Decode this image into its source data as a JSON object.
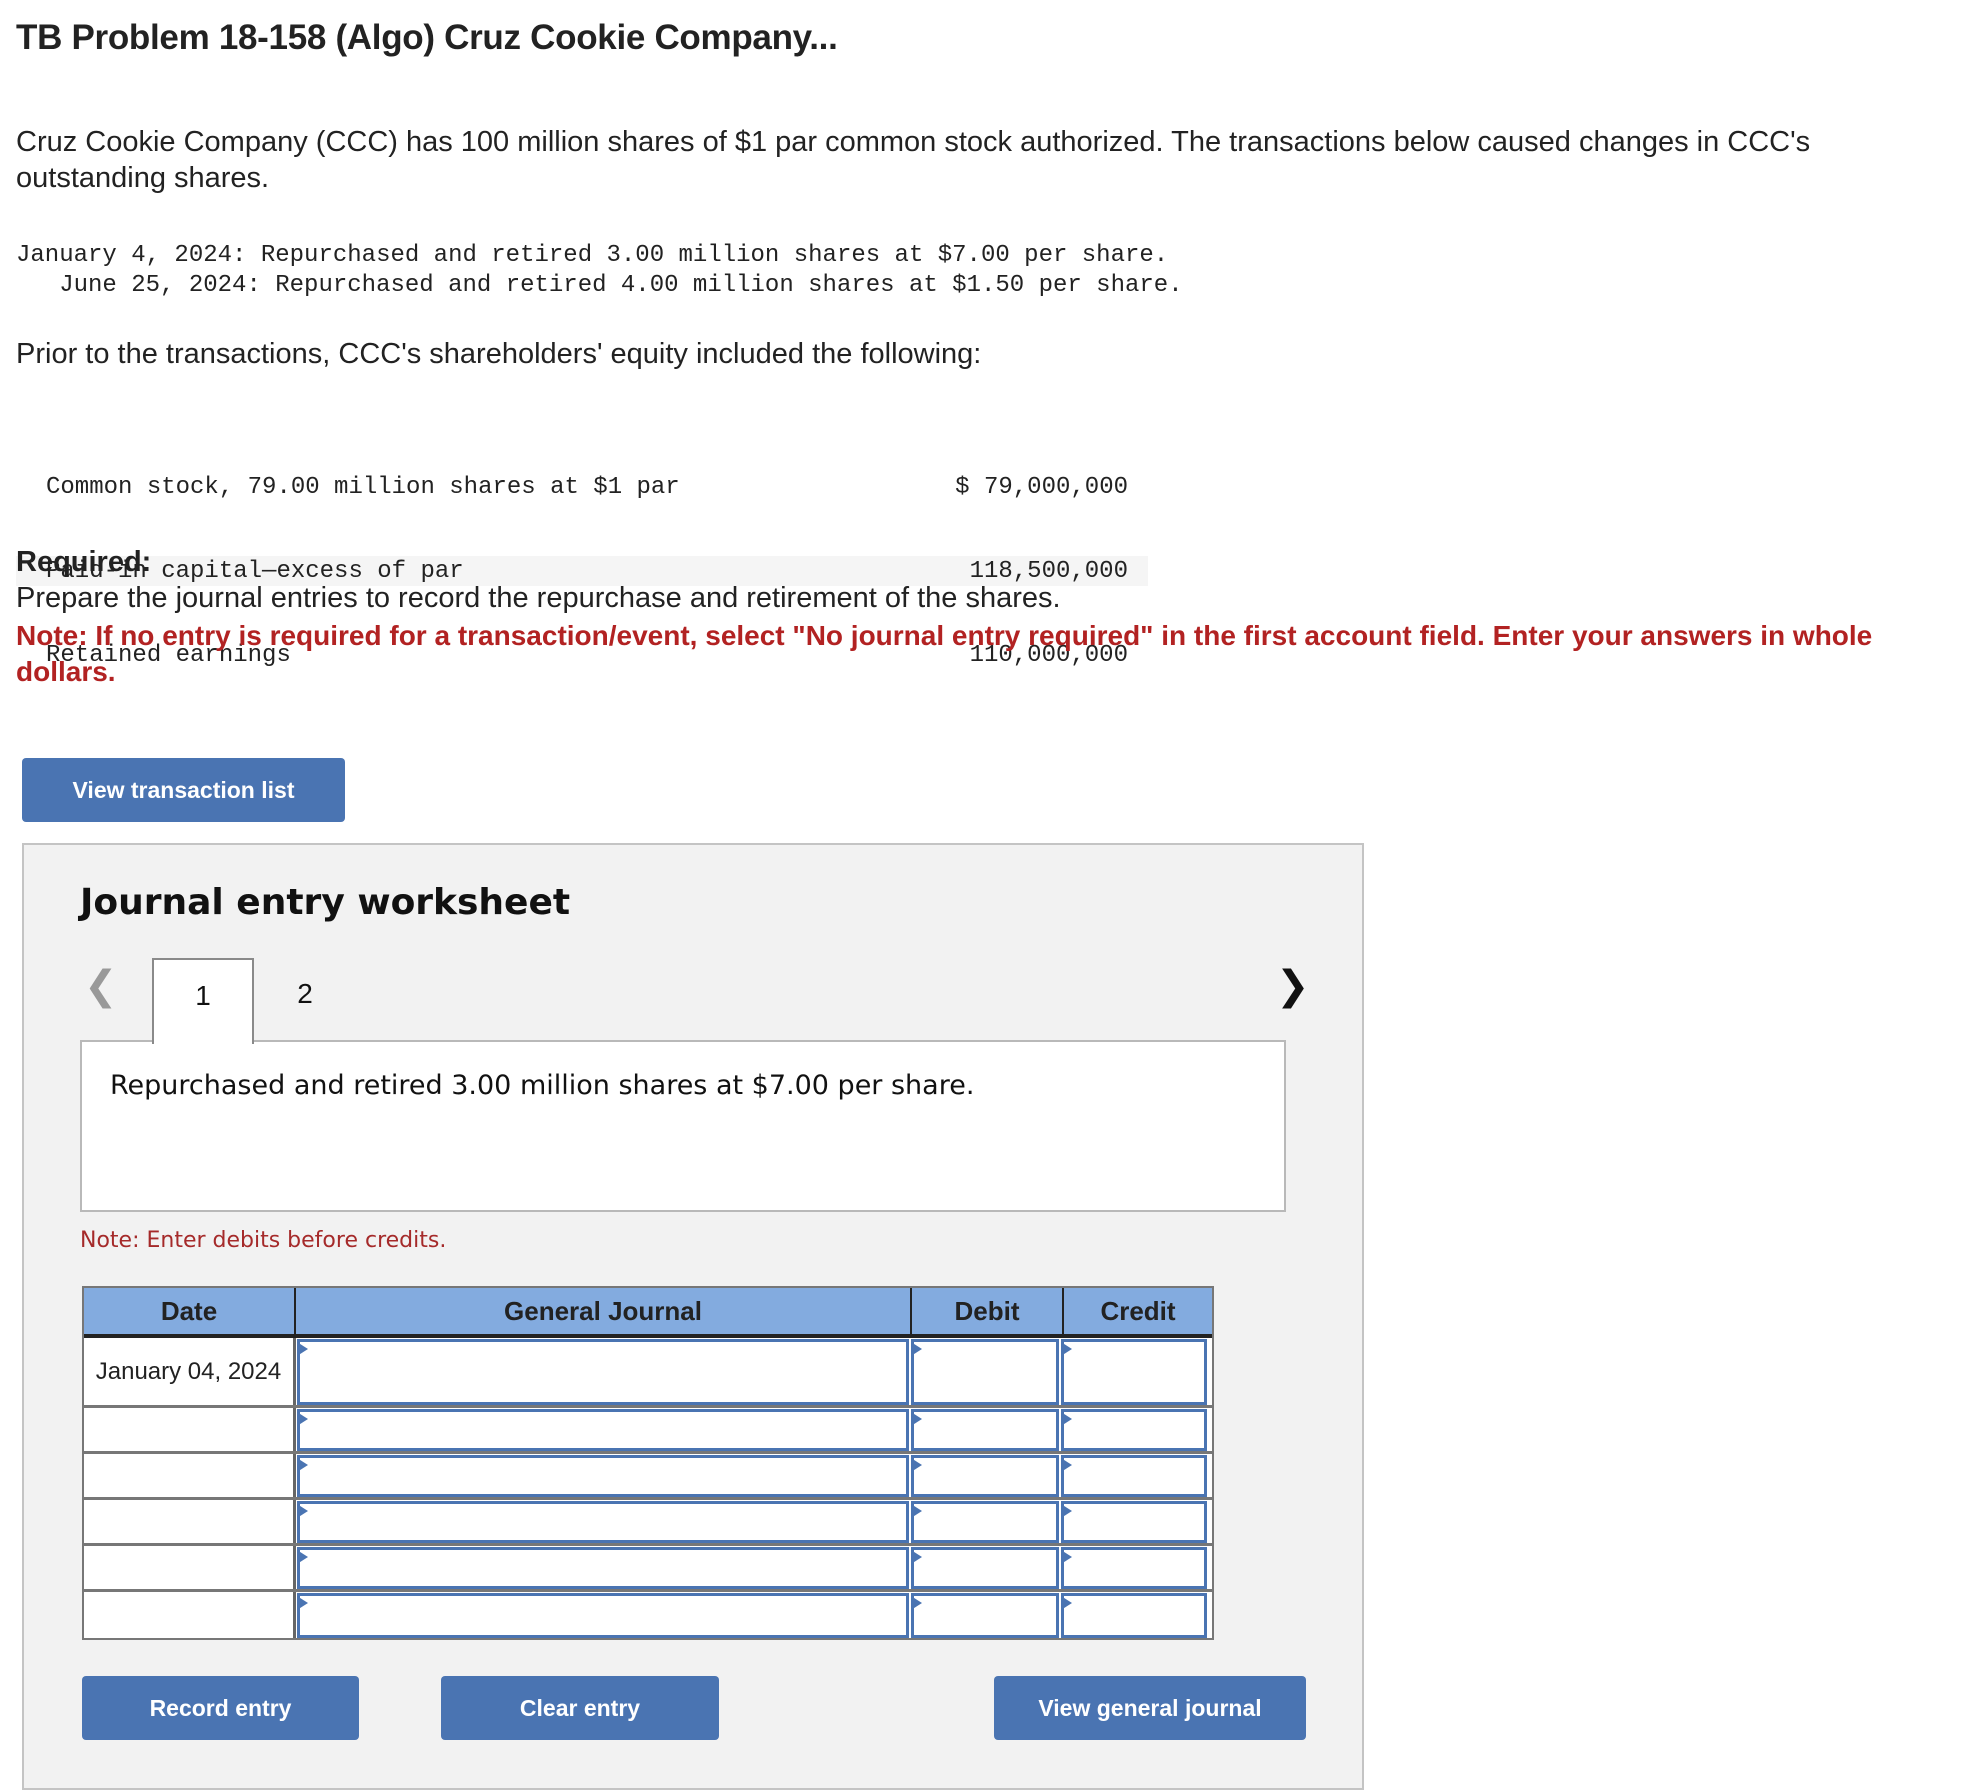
{
  "title": "TB Problem 18-158 (Algo) Cruz Cookie Company...",
  "intro": "Cruz Cookie Company (CCC) has 100 million shares of $1 par common stock authorized. The transactions below caused changes in CCC's outstanding shares.",
  "transactions": [
    {
      "date": "January 4, 2024:",
      "text": "Repurchased and retired 3.00 million shares at $7.00 per share."
    },
    {
      "date": "   June 25, 2024:",
      "text": "Repurchased and retired 4.00 million shares at $1.50 per share."
    }
  ],
  "prior_text": "Prior to the transactions, CCC's shareholders' equity included the following:",
  "equity": [
    {
      "label": "Common stock, 79.00 million shares at $1 par",
      "value": "$ 79,000,000"
    },
    {
      "label": "Paid-in capital—excess of par",
      "value": "118,500,000"
    },
    {
      "label": "Retained earnings",
      "value": "110,000,000"
    }
  ],
  "required": {
    "heading": "Required:",
    "text": "Prepare the journal entries to record the repurchase and retirement of the shares.",
    "note": "Note: If no entry is required for a transaction/event, select \"No journal entry required\" in the first account field. Enter your answers in whole dollars."
  },
  "buttons": {
    "view_transaction_list": "View transaction list",
    "record_entry": "Record entry",
    "clear_entry": "Clear entry",
    "view_general_journal": "View general journal"
  },
  "worksheet": {
    "heading": "Journal entry worksheet",
    "prev_icon": "chevron-left-icon",
    "next_icon": "chevron-right-icon",
    "tabs": [
      "1",
      "2"
    ],
    "active_tab": "1",
    "description": "Repurchased and retired 3.00 million shares at $7.00 per share.",
    "enter_note": "Note: Enter debits before credits.",
    "table": {
      "headers": [
        "Date",
        "General Journal",
        "Debit",
        "Credit"
      ],
      "rows": [
        {
          "date": "January 04, 2024",
          "account": "",
          "debit": "",
          "credit": ""
        },
        {
          "date": "",
          "account": "",
          "debit": "",
          "credit": ""
        },
        {
          "date": "",
          "account": "",
          "debit": "",
          "credit": ""
        },
        {
          "date": "",
          "account": "",
          "debit": "",
          "credit": ""
        },
        {
          "date": "",
          "account": "",
          "debit": "",
          "credit": ""
        },
        {
          "date": "",
          "account": "",
          "debit": "",
          "credit": ""
        }
      ]
    }
  },
  "colors": {
    "button_blue": "#4a74b2",
    "header_blue": "#83abdf",
    "note_red": "#b22222",
    "panel_bg": "#f2f2f2"
  }
}
